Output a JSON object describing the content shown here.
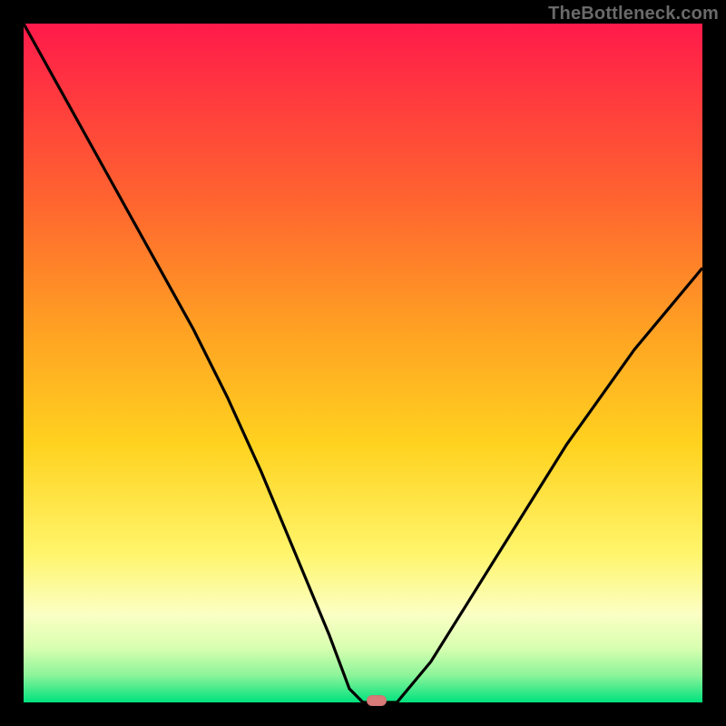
{
  "watermark": "TheBottleneck.com",
  "marker": {
    "x_pct": 52,
    "y_pct": 0
  },
  "colors": {
    "curve_stroke": "#000000",
    "marker": "#d87a78",
    "gradient_stops": [
      "#ff1a4b",
      "#ff3d3d",
      "#ff6a2e",
      "#ffa123",
      "#ffd21f",
      "#fff56b",
      "#fbffc4",
      "#d8ffb0",
      "#8cf49a",
      "#00e27e"
    ]
  },
  "chart_data": {
    "type": "line",
    "title": "",
    "xlabel": "",
    "ylabel": "",
    "xlim": [
      0,
      100
    ],
    "ylim": [
      0,
      100
    ],
    "series": [
      {
        "name": "bottleneck-curve",
        "x": [
          0,
          5,
          10,
          15,
          20,
          25,
          30,
          35,
          40,
          45,
          48,
          50,
          52,
          55,
          60,
          65,
          70,
          75,
          80,
          85,
          90,
          95,
          100
        ],
        "y": [
          100,
          91,
          82,
          73,
          64,
          55,
          45,
          34,
          22,
          10,
          2,
          0,
          0,
          0,
          6,
          14,
          22,
          30,
          38,
          45,
          52,
          58,
          64
        ]
      }
    ],
    "annotations": [
      {
        "name": "optimal-marker",
        "x": 52,
        "y": 0
      }
    ]
  }
}
